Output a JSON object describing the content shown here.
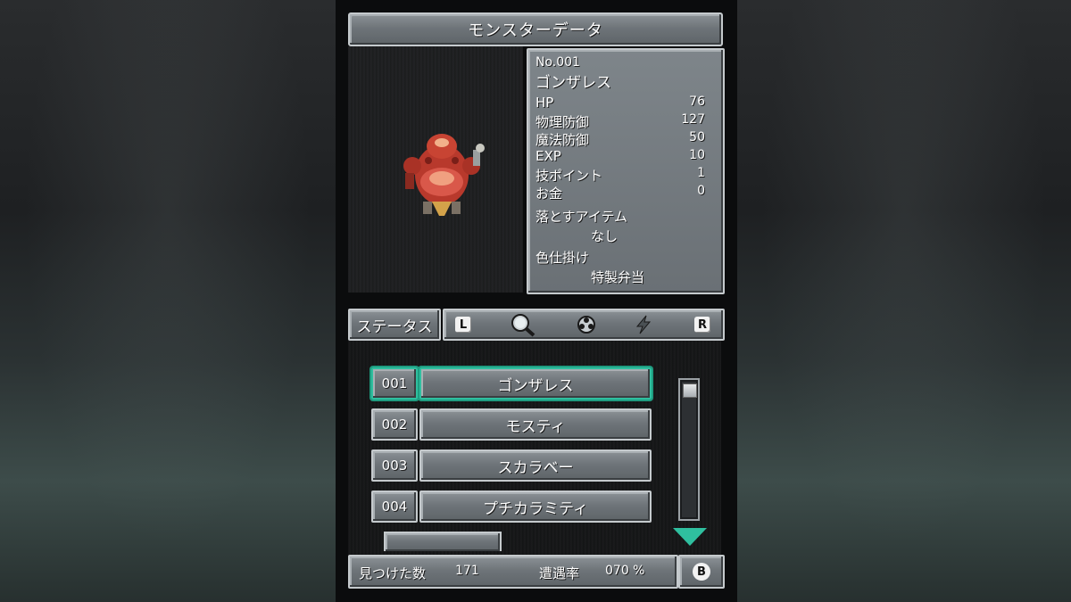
{
  "title": "モンスターデータ",
  "monster": {
    "number": "No.001",
    "name": "ゴンザレス",
    "stats": [
      {
        "label": "HP",
        "value": "76"
      },
      {
        "label": "物理防御",
        "value": "127"
      },
      {
        "label": "魔法防御",
        "value": "50"
      },
      {
        "label": "EXP",
        "value": "10"
      },
      {
        "label": "技ポイント",
        "value": "1"
      },
      {
        "label": "お金",
        "value": "0"
      }
    ],
    "drop_label": "落とすアイテム",
    "drop_value": "なし",
    "charm_label": "色仕掛け",
    "charm_value": "特製弁当"
  },
  "tabs": {
    "status_label": "ステータス",
    "l_key": "L",
    "r_key": "R",
    "icons": [
      "magnifier-icon",
      "orb-icon",
      "lightning-icon"
    ]
  },
  "list": [
    {
      "num": "001",
      "name": "ゴンザレス",
      "selected": true
    },
    {
      "num": "002",
      "name": "モスティ",
      "selected": false
    },
    {
      "num": "003",
      "name": "スカラベー",
      "selected": false
    },
    {
      "num": "004",
      "name": "プチカラミティ",
      "selected": false
    }
  ],
  "footer": {
    "found_label": "見つけた数",
    "found_value": "171",
    "encounter_label": "遭遇率",
    "encounter_value": "070 %",
    "back_key": "B"
  },
  "colors": {
    "accent": "#2fbf9f",
    "panel": "#6e7479",
    "border": "#c5cacd"
  }
}
